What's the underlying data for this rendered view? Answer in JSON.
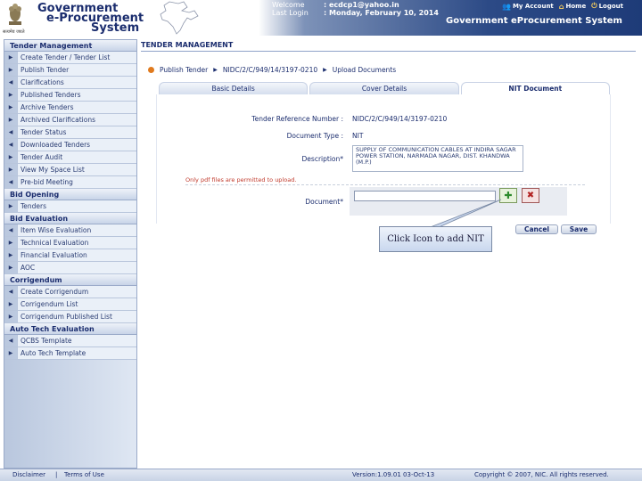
{
  "header": {
    "logo_line1": "Government",
    "logo_line2": "e-Procurement",
    "logo_line3": "System",
    "emblem_caption": "सत्यमेव जयते",
    "welcome_label": "Welcome",
    "welcome_value": ": ecdcp1@yahoo.in",
    "last_login_label": "Last Login",
    "last_login_value": ": Monday, February 10, 2014",
    "links": [
      {
        "icon": "my-account-icon",
        "label": "My Account"
      },
      {
        "icon": "home-icon",
        "label": "Home"
      },
      {
        "icon": "logout-icon",
        "label": "Logout"
      }
    ],
    "system_title": "Government eProcurement System"
  },
  "sidebar": {
    "sections": [
      {
        "title": "Tender Management",
        "items": [
          "Create Tender / Tender List",
          "Publish Tender",
          "Clarifications",
          "Published Tenders",
          "Archive Tenders",
          "Archived Clarifications",
          "Tender Status",
          "Downloaded Tenders",
          "Tender Audit",
          "View My Space List",
          "Pre-bid Meeting"
        ]
      },
      {
        "title": "Bid Opening",
        "items": [
          "Tenders"
        ]
      },
      {
        "title": "Bid Evaluation",
        "items": [
          "Item Wise Evaluation",
          "Technical Evaluation",
          "Financial Evaluation",
          "AOC"
        ]
      },
      {
        "title": "Corrigendum",
        "items": [
          "Create Corrigendum",
          "Corrigendum List",
          "Corrigendum Published List"
        ]
      },
      {
        "title": "Auto Tech Evaluation",
        "items": [
          "QCBS Template",
          "Auto Tech Template"
        ]
      }
    ]
  },
  "main": {
    "title": "TENDER MANAGEMENT",
    "breadcrumb": [
      "Publish Tender",
      "NIDC/2/C/949/14/3197-0210",
      "Upload Documents"
    ],
    "tabs": [
      "Basic Details",
      "Cover Details",
      "NIT Document"
    ],
    "fields": {
      "ref_label": "Tender Reference Number :",
      "ref_value": "NIDC/2/C/949/14/3197-0210",
      "doctype_label": "Document Type :",
      "doctype_value": "NIT",
      "desc_label": "Description*",
      "desc_value": "SUPPLY OF COMMUNICATION CABLES AT INDIRA SAGAR POWER STATION, NARMADA NAGAR, DIST. KHANDWA (M.P.)",
      "note": "Only pdf files are permitted to upload.",
      "document_label": "Document*"
    },
    "callout": "Click Icon to add NIT",
    "cancel_label": "Cancel",
    "save_label": "Save"
  },
  "footer": {
    "disclaimer": "Disclaimer",
    "terms": "Terms of Use",
    "version": "Version:1.09.01 03-Oct-13",
    "copyright": "Copyright © 2007, NIC. All rights reserved."
  },
  "colors": {
    "brand_navy": "#1b2d6e",
    "header_band": "#2c4a86",
    "accent_orange": "#e07a1e",
    "note_red": "#c0392b"
  }
}
